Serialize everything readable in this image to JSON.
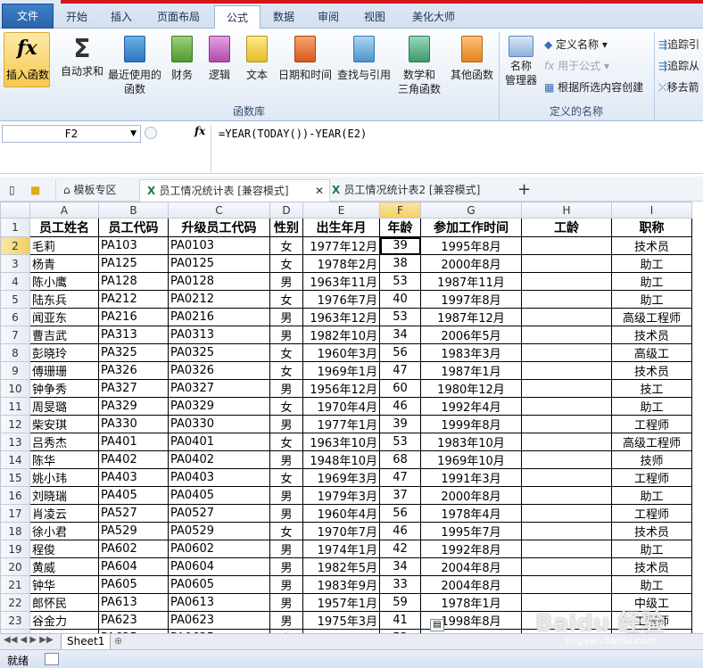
{
  "ribbon_tabs": [
    "文件",
    "开始",
    "插入",
    "页面布局",
    "公式",
    "数据",
    "审阅",
    "视图",
    "美化大师"
  ],
  "active_tab": "公式",
  "formula_groups": {
    "insert_function": "插入函数",
    "autosum": "自动求和",
    "recent_line1": "最近使用的",
    "recent_line2": "函数",
    "financial": "财务",
    "logical": "逻辑",
    "text": "文本",
    "datetime": "日期和时间",
    "lookup": "查找与引用",
    "math_line1": "数学和",
    "math_line2": "三角函数",
    "other": "其他函数",
    "library_label": "函数库",
    "name_manager_line1": "名称",
    "name_manager_line2": "管理器",
    "define_name": "定义名称",
    "use_in_formula": "用于公式",
    "create_from_selection": "根据所选内容创建",
    "defined_names_label": "定义的名称",
    "trace_precedents": "追踪引",
    "trace_dependents": "追踪从",
    "remove_arrows": "移去箭"
  },
  "name_box": "F2",
  "fx_symbol": "fx",
  "formula": "=YEAR(TODAY())-YEAR(E2)",
  "doc_tabs": {
    "template": "模板专区",
    "file1": "员工情况统计表 [兼容模式]",
    "file2": "员工情况统计表2 [兼容模式]",
    "add": "+"
  },
  "columns": [
    "A",
    "B",
    "C",
    "D",
    "E",
    "F",
    "G",
    "H",
    "I"
  ],
  "header_row": [
    "员工姓名",
    "员工代码",
    "升级员工代码",
    "性别",
    "出生年月",
    "年龄",
    "参加工作时间",
    "工龄",
    "职称"
  ],
  "rows": [
    [
      "毛莉",
      "PA103",
      "PA0103",
      "女",
      "1977年12月",
      "39",
      "1995年8月",
      "",
      "技术员"
    ],
    [
      "杨青",
      "PA125",
      "PA0125",
      "女",
      "1978年2月",
      "38",
      "2000年8月",
      "",
      "助工"
    ],
    [
      "陈小鹰",
      "PA128",
      "PA0128",
      "男",
      "1963年11月",
      "53",
      "1987年11月",
      "",
      "助工"
    ],
    [
      "陆东兵",
      "PA212",
      "PA0212",
      "女",
      "1976年7月",
      "40",
      "1997年8月",
      "",
      "助工"
    ],
    [
      "闻亚东",
      "PA216",
      "PA0216",
      "男",
      "1963年12月",
      "53",
      "1987年12月",
      "",
      "高级工程师"
    ],
    [
      "曹吉武",
      "PA313",
      "PA0313",
      "男",
      "1982年10月",
      "34",
      "2006年5月",
      "",
      "技术员"
    ],
    [
      "彭晓玲",
      "PA325",
      "PA0325",
      "女",
      "1960年3月",
      "56",
      "1983年3月",
      "",
      "高级工"
    ],
    [
      "傅珊珊",
      "PA326",
      "PA0326",
      "女",
      "1969年1月",
      "47",
      "1987年1月",
      "",
      "技术员"
    ],
    [
      "钟争秀",
      "PA327",
      "PA0327",
      "男",
      "1956年12月",
      "60",
      "1980年12月",
      "",
      "技工"
    ],
    [
      "周旻璐",
      "PA329",
      "PA0329",
      "女",
      "1970年4月",
      "46",
      "1992年4月",
      "",
      "助工"
    ],
    [
      "柴安琪",
      "PA330",
      "PA0330",
      "男",
      "1977年1月",
      "39",
      "1999年8月",
      "",
      "工程师"
    ],
    [
      "吕秀杰",
      "PA401",
      "PA0401",
      "女",
      "1963年10月",
      "53",
      "1983年10月",
      "",
      "高级工程师"
    ],
    [
      "陈华",
      "PA402",
      "PA0402",
      "男",
      "1948年10月",
      "68",
      "1969年10月",
      "",
      "技师"
    ],
    [
      "姚小玮",
      "PA403",
      "PA0403",
      "女",
      "1969年3月",
      "47",
      "1991年3月",
      "",
      "工程师"
    ],
    [
      "刘晓瑞",
      "PA405",
      "PA0405",
      "男",
      "1979年3月",
      "37",
      "2000年8月",
      "",
      "助工"
    ],
    [
      "肖凌云",
      "PA527",
      "PA0527",
      "男",
      "1960年4月",
      "56",
      "1978年4月",
      "",
      "工程师"
    ],
    [
      "徐小君",
      "PA529",
      "PA0529",
      "女",
      "1970年7月",
      "46",
      "1995年7月",
      "",
      "技术员"
    ],
    [
      "程俊",
      "PA602",
      "PA0602",
      "男",
      "1974年1月",
      "42",
      "1992年8月",
      "",
      "助工"
    ],
    [
      "黄威",
      "PA604",
      "PA0604",
      "男",
      "1982年5月",
      "34",
      "2004年8月",
      "",
      "技术员"
    ],
    [
      "钟华",
      "PA605",
      "PA0605",
      "男",
      "1983年9月",
      "33",
      "2004年8月",
      "",
      "助工"
    ],
    [
      "郎怀民",
      "PA613",
      "PA0613",
      "男",
      "1957年1月",
      "59",
      "1978年1月",
      "",
      "中级工"
    ],
    [
      "谷金力",
      "PA623",
      "PA0623",
      "男",
      "1975年3月",
      "41",
      "1998年8月",
      "",
      "工程师"
    ],
    [
      "张南玲",
      "PA625",
      "PA0625",
      "女",
      "1963年9月",
      "53",
      "1984年8月",
      "",
      "技工"
    ]
  ],
  "sheet_tab": "Sheet1",
  "status": "就绪",
  "watermark": "Baidu 经验",
  "watermark_url": "jingyan.baidu.com"
}
